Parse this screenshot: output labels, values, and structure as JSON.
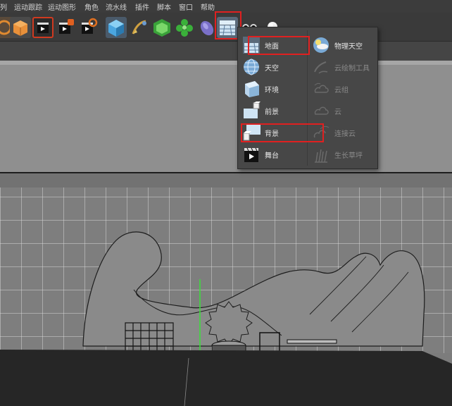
{
  "menubar": {
    "items": [
      "列",
      "运动跟踪",
      "运动图形",
      "角色",
      "流水线",
      "插件",
      "脚本",
      "窗口",
      "帮助"
    ]
  },
  "toolbar": {
    "icons": [
      "snap-icon",
      "cube-tool-icon",
      "render-view-icon",
      "render-picture-viewer-icon",
      "render-settings-icon",
      "cube-primitive-icon",
      "pen-spline-icon",
      "subdivision-icon",
      "cloner-icon",
      "deformer-icon",
      "floor-environment-icon",
      "camera-icon",
      "light-icon"
    ]
  },
  "dropdown": {
    "left_items": [
      {
        "label": "地面",
        "icon": "floor-icon"
      },
      {
        "label": "天空",
        "icon": "sky-icon"
      },
      {
        "label": "环境",
        "icon": "environment-icon"
      },
      {
        "label": "前景",
        "icon": "foreground-icon"
      },
      {
        "label": "背景",
        "icon": "background-icon"
      },
      {
        "label": "舞台",
        "icon": "stage-icon"
      }
    ],
    "right_items": [
      {
        "label": "物理天空",
        "icon": "physical-sky-icon",
        "enabled": true
      },
      {
        "label": "云绘制工具",
        "icon": "cloud-paint-icon",
        "enabled": false
      },
      {
        "label": "云组",
        "icon": "cloud-group-icon",
        "enabled": false
      },
      {
        "label": "云",
        "icon": "cloud-icon",
        "enabled": false
      },
      {
        "label": "连接云",
        "icon": "connect-cloud-icon",
        "enabled": false
      },
      {
        "label": "生长草坪",
        "icon": "grass-icon",
        "enabled": false
      }
    ]
  },
  "colors": {
    "highlight": "#e02020",
    "viewport_bg": "#7c7c7c",
    "panel_bg": "#8f8f8f",
    "menu_bg": "#474747"
  }
}
